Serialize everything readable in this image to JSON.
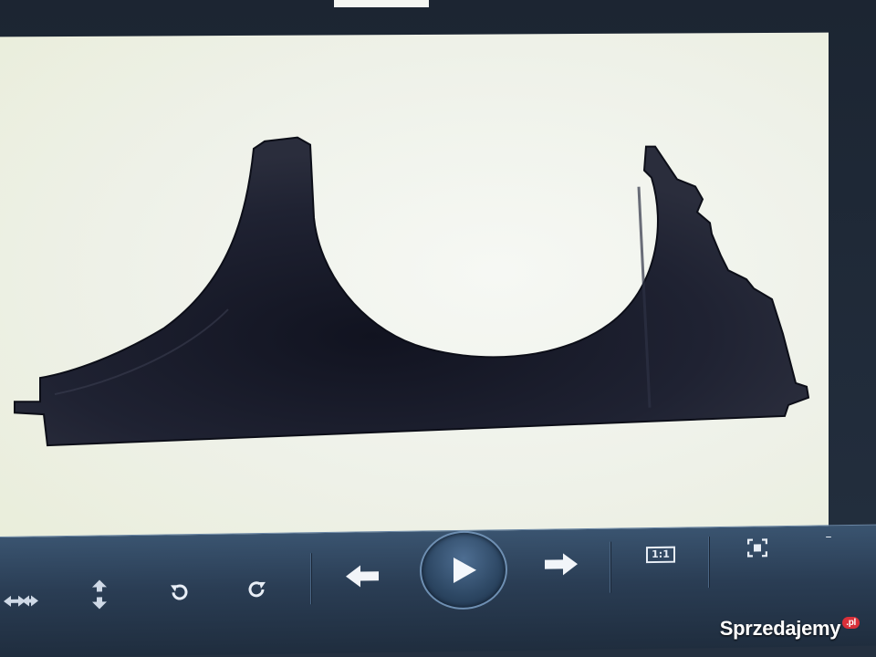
{
  "window": {
    "title": ""
  },
  "viewer": {
    "image_subject": "black plastic dashboard gauge holder",
    "zoom_label": "1:1"
  },
  "toolbar": {
    "buttons": [
      {
        "name": "fit-width-button",
        "icon": "horizontal-arrows-icon"
      },
      {
        "name": "fit-height-button",
        "icon": "vertical-arrows-icon"
      },
      {
        "name": "rotate-left-button",
        "icon": "rotate-ccw-icon"
      },
      {
        "name": "rotate-right-button",
        "icon": "rotate-cw-icon"
      },
      {
        "name": "previous-button",
        "icon": "arrow-left-icon"
      },
      {
        "name": "play-slideshow-button",
        "icon": "play-icon"
      },
      {
        "name": "next-button",
        "icon": "arrow-right-icon"
      },
      {
        "name": "actual-size-button",
        "icon": "one-to-one-icon"
      },
      {
        "name": "fullscreen-button",
        "icon": "fullscreen-icon"
      }
    ],
    "minimize_label": "–"
  },
  "watermark": {
    "text": "Sprzedajemy",
    "badge": ".pl"
  },
  "colors": {
    "toolbar": "#2a3d54",
    "accent": "#6e8fb2",
    "photo_bg": "#eef1e8",
    "part": "#1b1d2a"
  }
}
